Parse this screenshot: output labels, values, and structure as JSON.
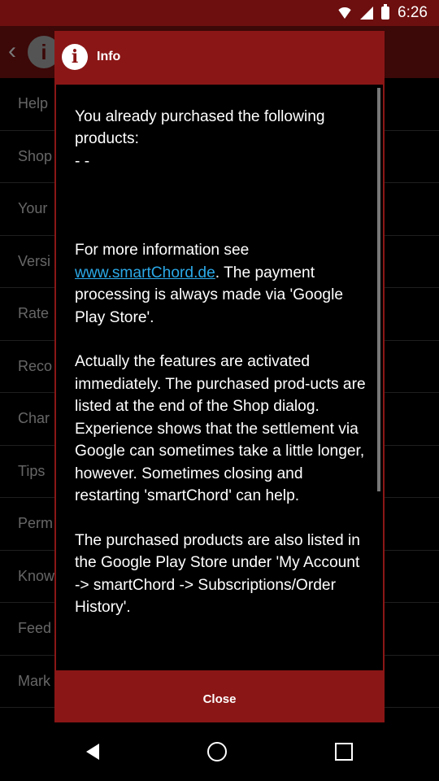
{
  "status_bar": {
    "time": "6:26"
  },
  "background": {
    "items": [
      "Help",
      "Shop",
      "Your",
      "Versi",
      "Rate",
      "Reco",
      "Char",
      "Tips",
      "Perm",
      "Know",
      "Feed",
      "Mark"
    ]
  },
  "dialog": {
    "title": "Info",
    "message_before_link": "You already purchased the following products:\n- -\n\n\n\nFor more information see ",
    "link": "www.smartChord.de",
    "message_after_link": ". The payment processing is always made via 'Google Play Store'.\n\nActually the features are activated immediately. The purchased prod-ucts are listed at the end of the Shop dialog. Experience shows that the settlement via Google can sometimes take a little longer, however. Sometimes closing and restarting 'smartChord' can help.\n\nThe purchased products are also listed in the Google Play Store under 'My Account -> smartChord -> Subscriptions/Order History'.",
    "close_label": "Close"
  },
  "colors": {
    "dialog_bg": "#8b1616",
    "link": "#2ba9e8",
    "app_bar": "#6d0f0f"
  }
}
